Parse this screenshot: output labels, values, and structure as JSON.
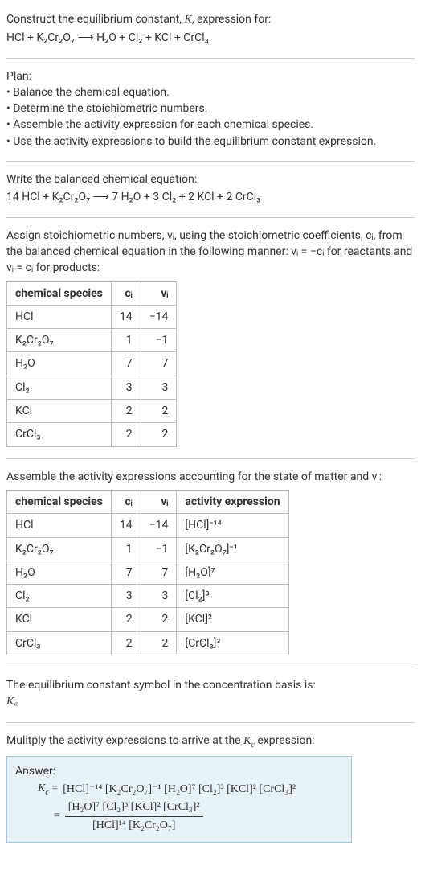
{
  "header": {
    "prompt_line1": "Construct the equilibrium constant, K, expression for:",
    "prompt_eqn": "HCl + K₂Cr₂O₇ ⟶ H₂O + Cl₂ + KCl + CrCl₃"
  },
  "plan": {
    "title": "Plan:",
    "bullets": [
      "• Balance the chemical equation.",
      "• Determine the stoichiometric numbers.",
      "• Assemble the activity expression for each chemical species.",
      "• Use the activity expressions to build the equilibrium constant expression."
    ]
  },
  "balanced": {
    "title": "Write the balanced chemical equation:",
    "eqn": "14 HCl + K₂Cr₂O₇ ⟶ 7 H₂O + 3 Cl₂ + 2 KCl + 2 CrCl₃"
  },
  "stoich": {
    "intro": "Assign stoichiometric numbers, νᵢ, using the stoichiometric coefficients, cᵢ, from the balanced chemical equation in the following manner: νᵢ = −cᵢ for reactants and νᵢ = cᵢ for products:",
    "headers": {
      "species": "chemical species",
      "ci": "cᵢ",
      "vi": "νᵢ"
    },
    "rows": [
      {
        "species": "HCl",
        "ci": "14",
        "vi": "−14"
      },
      {
        "species": "K₂Cr₂O₇",
        "ci": "1",
        "vi": "−1"
      },
      {
        "species": "H₂O",
        "ci": "7",
        "vi": "7"
      },
      {
        "species": "Cl₂",
        "ci": "3",
        "vi": "3"
      },
      {
        "species": "KCl",
        "ci": "2",
        "vi": "2"
      },
      {
        "species": "CrCl₃",
        "ci": "2",
        "vi": "2"
      }
    ]
  },
  "activity": {
    "intro": "Assemble the activity expressions accounting for the state of matter and νᵢ:",
    "headers": {
      "species": "chemical species",
      "ci": "cᵢ",
      "vi": "νᵢ",
      "expr": "activity expression"
    },
    "rows": [
      {
        "species": "HCl",
        "ci": "14",
        "vi": "−14",
        "expr": "[HCl]⁻¹⁴"
      },
      {
        "species": "K₂Cr₂O₇",
        "ci": "1",
        "vi": "−1",
        "expr": "[K₂Cr₂O₇]⁻¹"
      },
      {
        "species": "H₂O",
        "ci": "7",
        "vi": "7",
        "expr": "[H₂O]⁷"
      },
      {
        "species": "Cl₂",
        "ci": "3",
        "vi": "3",
        "expr": "[Cl₂]³"
      },
      {
        "species": "KCl",
        "ci": "2",
        "vi": "2",
        "expr": "[KCl]²"
      },
      {
        "species": "CrCl₃",
        "ci": "2",
        "vi": "2",
        "expr": "[CrCl₃]²"
      }
    ]
  },
  "symbol": {
    "title": "The equilibrium constant symbol in the concentration basis is:",
    "value": "K꜀"
  },
  "multiply": {
    "title": "Mulitply the activity expressions to arrive at the K꜀ expression:"
  },
  "answer": {
    "label": "Answer:",
    "kc_label": "K꜀ = ",
    "eq": " = ",
    "line1": "[HCl]⁻¹⁴ [K₂Cr₂O₇]⁻¹ [H₂O]⁷ [Cl₂]³ [KCl]² [CrCl₃]²",
    "frac_num": "[H₂O]⁷ [Cl₂]³ [KCl]² [CrCl₃]²",
    "frac_den": "[HCl]¹⁴ [K₂Cr₂O₇]"
  }
}
